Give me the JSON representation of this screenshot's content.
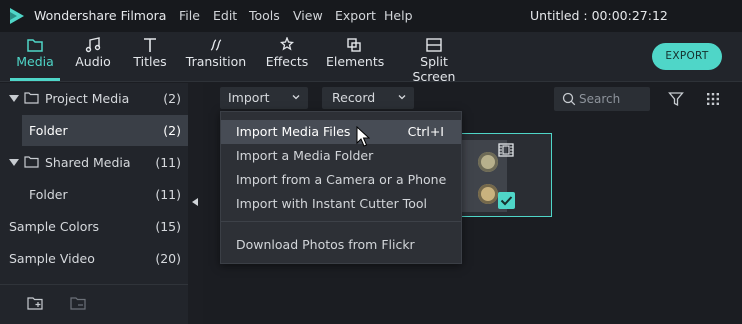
{
  "app": {
    "name": "Wondershare Filmora",
    "title": "Untitled : 00:00:27:12",
    "menu": [
      "File",
      "Edit",
      "Tools",
      "View",
      "Export",
      "Help"
    ]
  },
  "toolbar": {
    "tabs": [
      {
        "label": "Media",
        "icon": "folder-icon",
        "active": true
      },
      {
        "label": "Audio",
        "icon": "music-note-icon",
        "active": false
      },
      {
        "label": "Titles",
        "icon": "text-icon",
        "active": false
      },
      {
        "label": "Transition",
        "icon": "transition-icon",
        "active": false
      },
      {
        "label": "Effects",
        "icon": "effects-icon",
        "active": false
      },
      {
        "label": "Elements",
        "icon": "elements-icon",
        "active": false
      },
      {
        "label": "Split Screen",
        "icon": "split-screen-icon",
        "active": false
      }
    ],
    "export_label": "EXPORT"
  },
  "sidebar": {
    "items": [
      {
        "label": "Project Media",
        "count": "(2)"
      },
      {
        "label": "Folder",
        "count": "(2)"
      },
      {
        "label": "Shared Media",
        "count": "(11)"
      },
      {
        "label": "Folder",
        "count": "(11)"
      },
      {
        "label": "Sample Colors",
        "count": "(15)"
      },
      {
        "label": "Sample Video",
        "count": "(20)"
      }
    ]
  },
  "media_bar": {
    "import_label": "Import",
    "record_label": "Record",
    "search_placeholder": "Search"
  },
  "import_menu": {
    "items": [
      {
        "label": "Import Media Files",
        "shortcut": "Ctrl+I"
      },
      {
        "label": "Import a Media Folder",
        "shortcut": ""
      },
      {
        "label": "Import from a Camera or a Phone",
        "shortcut": ""
      },
      {
        "label": "Import with Instant Cutter Tool",
        "shortcut": ""
      },
      {
        "label": "Download Photos from Flickr",
        "shortcut": ""
      }
    ]
  },
  "colors": {
    "accent": "#4fd6c8",
    "background": "#1b1d22",
    "panel": "#22252b"
  }
}
